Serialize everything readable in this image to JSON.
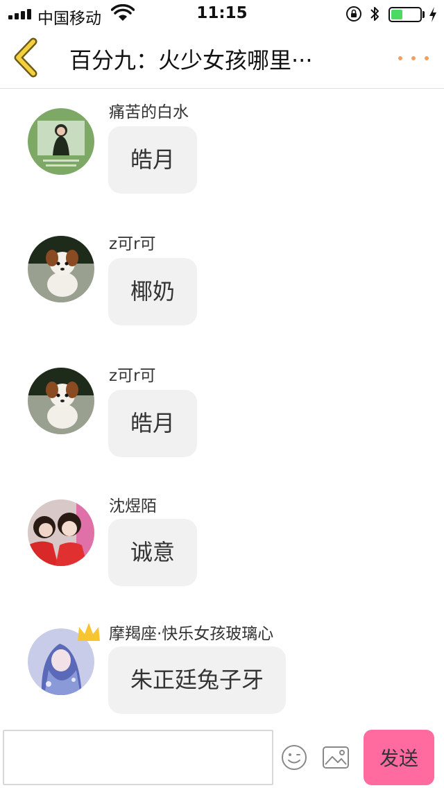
{
  "status_bar": {
    "carrier": "中国移动",
    "time": "11:15",
    "battery_level": 0.4
  },
  "header": {
    "title": "百分九：火少女孩哪里···"
  },
  "messages": [
    {
      "sender": "痛苦的白水",
      "text": "皓月",
      "avatar": "avatar-girl-green"
    },
    {
      "sender": "z可r可",
      "text": "椰奶",
      "avatar": "avatar-puppy"
    },
    {
      "sender": "z可r可",
      "text": "皓月",
      "avatar": "avatar-puppy"
    },
    {
      "sender": "沈煜陌",
      "text": "诚意",
      "avatar": "avatar-girl-red"
    },
    {
      "sender": "摩羯座·快乐女孩玻璃心",
      "text": "朱正廷兔子牙",
      "avatar": "avatar-anime-crown"
    }
  ],
  "input_bar": {
    "placeholder": "",
    "value": "",
    "send_label": "发送"
  },
  "colors": {
    "accent_back": "#f4d03f",
    "more_dots": "#f0a060",
    "send_button": "#ff6b9f",
    "bubble": "#f1f1f1"
  }
}
